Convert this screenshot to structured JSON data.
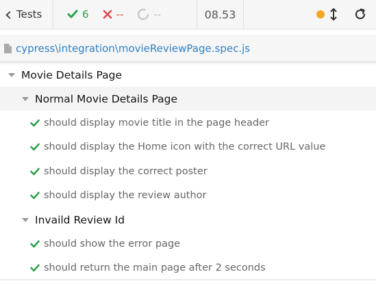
{
  "header": {
    "tests_label": "Tests",
    "passed": "6",
    "failed": "--",
    "pending": "--",
    "duration": "08.53"
  },
  "spec": {
    "path": "cypress\\integration\\movieReviewPage.spec.js"
  },
  "suites": [
    {
      "title": "Movie Details Page",
      "children": [
        {
          "title": "Normal Movie Details Page",
          "tests": [
            "should display movie title in the page header",
            "should display the Home icon with the correct URL value",
            "should display the correct poster",
            "should display the review author"
          ]
        },
        {
          "title": "Invaild Review Id",
          "tests": [
            "should show the error page",
            "should return the main page after 2 seconds"
          ]
        }
      ]
    }
  ],
  "colors": {
    "passed": "#2da14c",
    "failed": "#e0484a",
    "pending": "#bbbbbb",
    "running_dot": "#f6a623",
    "link": "#3380c0"
  },
  "icons": {
    "back": "chevron-left-icon",
    "passed": "check-icon",
    "failed": "x-icon",
    "pending": "circle-icon",
    "status": "status-dot-icon",
    "scroll": "vertical-arrows-icon",
    "reload": "reload-icon",
    "file": "file-icon",
    "collapse": "caret-down-icon"
  }
}
